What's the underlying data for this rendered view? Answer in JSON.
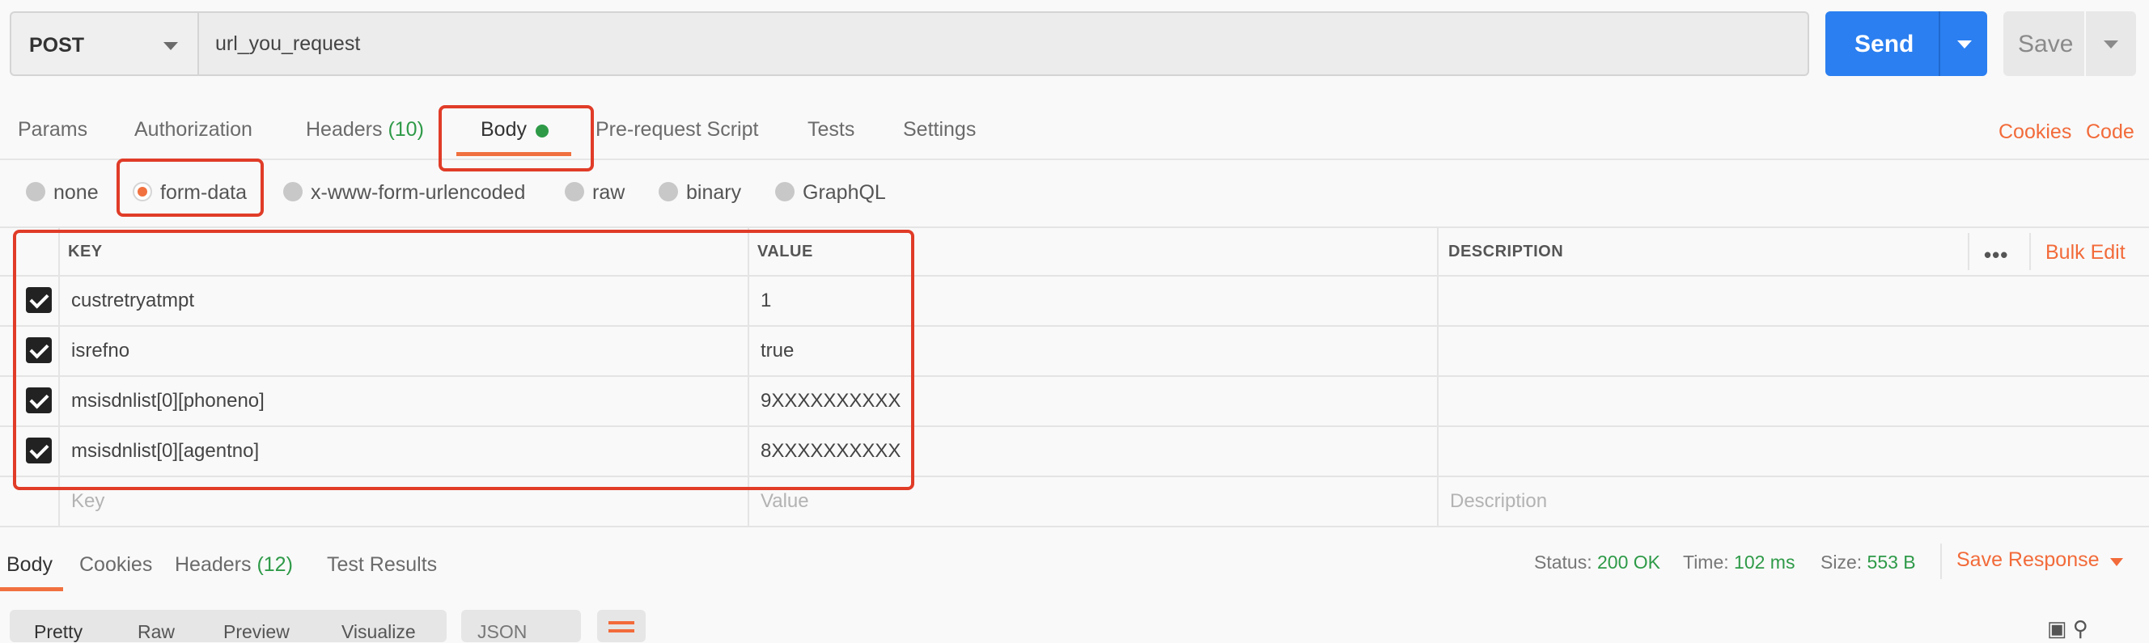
{
  "request": {
    "method": "POST",
    "url": "url_you_request",
    "send_label": "Send",
    "save_label": "Save"
  },
  "tabs": {
    "params": "Params",
    "authorization": "Authorization",
    "headers": "Headers",
    "headers_count": "(10)",
    "body": "Body",
    "prerequest": "Pre-request Script",
    "tests": "Tests",
    "settings": "Settings",
    "cookies": "Cookies",
    "code": "Code"
  },
  "body_types": {
    "none": "none",
    "form_data": "form-data",
    "urlencoded": "x-www-form-urlencoded",
    "raw": "raw",
    "binary": "binary",
    "graphql": "GraphQL",
    "selected": "form-data"
  },
  "table": {
    "headers": {
      "key": "KEY",
      "value": "VALUE",
      "description": "DESCRIPTION",
      "more": "•••",
      "bulk_edit": "Bulk Edit"
    },
    "rows": [
      {
        "key": "custretryatmpt",
        "value": "1",
        "checked": true
      },
      {
        "key": "isrefno",
        "value": "true",
        "checked": true
      },
      {
        "key": "msisdnlist[0][phoneno]",
        "value": "9XXXXXXXXXX",
        "checked": true
      },
      {
        "key": "msisdnlist[0][agentno]",
        "value": "8XXXXXXXXXX",
        "checked": true
      }
    ],
    "placeholders": {
      "key": "Key",
      "value": "Value",
      "description": "Description"
    }
  },
  "response": {
    "tabs": {
      "body": "Body",
      "cookies": "Cookies",
      "headers": "Headers",
      "headers_count": "(12)",
      "test_results": "Test Results"
    },
    "status_label": "Status:",
    "status_value": "200 OK",
    "time_label": "Time:",
    "time_value": "102 ms",
    "size_label": "Size:",
    "size_value": "553 B",
    "save_response": "Save Response",
    "view_modes": [
      "Pretty",
      "Raw",
      "Preview",
      "Visualize"
    ],
    "format": "JSON"
  },
  "colors": {
    "accent": "#f26b3a",
    "send_blue": "#2b7ff0",
    "success_green": "#2e9a48",
    "highlight_red": "#e03c28"
  }
}
